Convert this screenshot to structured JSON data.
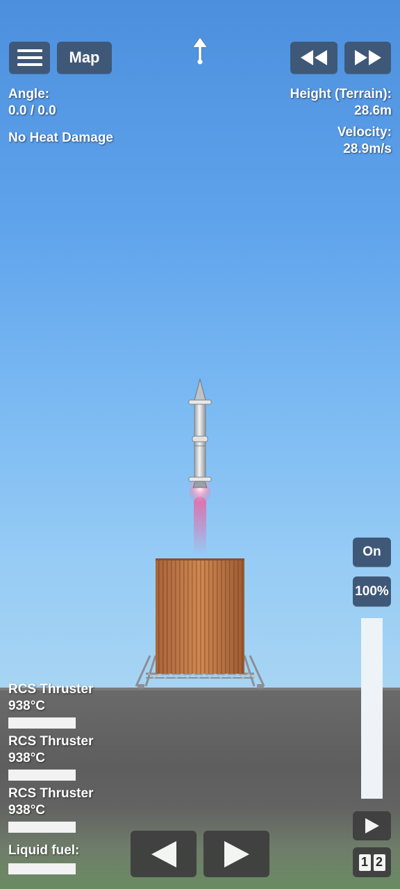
{
  "toolbar": {
    "menu_icon": "hamburger-menu-icon",
    "map_label": "Map",
    "heading_icon": "up-arrow-icon",
    "rewind_icon": "rewind-icon",
    "fast_forward_icon": "fast-forward-icon"
  },
  "hud_left": {
    "angle_label": "Angle:",
    "angle_value": "0.0 / 0.0",
    "heat_status": "No Heat Damage"
  },
  "hud_right": {
    "height_label": "Height (Terrain):",
    "height_value": "28.6m",
    "velocity_label": "Velocity:",
    "velocity_value": "28.9m/s"
  },
  "parts": [
    {
      "name": "RCS Thruster",
      "temp": "938°C",
      "level": 1.0
    },
    {
      "name": "RCS Thruster",
      "temp": "938°C",
      "level": 1.0
    },
    {
      "name": "RCS Thruster",
      "temp": "938°C",
      "level": 1.0
    }
  ],
  "fuel": {
    "label": "Liquid fuel:",
    "level": 1.0
  },
  "throttle": {
    "toggle_label": "On",
    "percent_label": "100%",
    "level": 1.0
  },
  "controls": {
    "left_icon": "rotate-left-icon",
    "right_icon": "rotate-right-icon",
    "play_icon": "play-stage-icon",
    "stage_1": "1",
    "stage_2": "2"
  },
  "colors": {
    "button_blue": "#3f5878",
    "sky_top": "#4c8fdd",
    "sky_horizon": "#b0d6ee",
    "ground": "#5e5e5e",
    "tower": "#c17a45",
    "exhaust": "#e06fa8"
  }
}
